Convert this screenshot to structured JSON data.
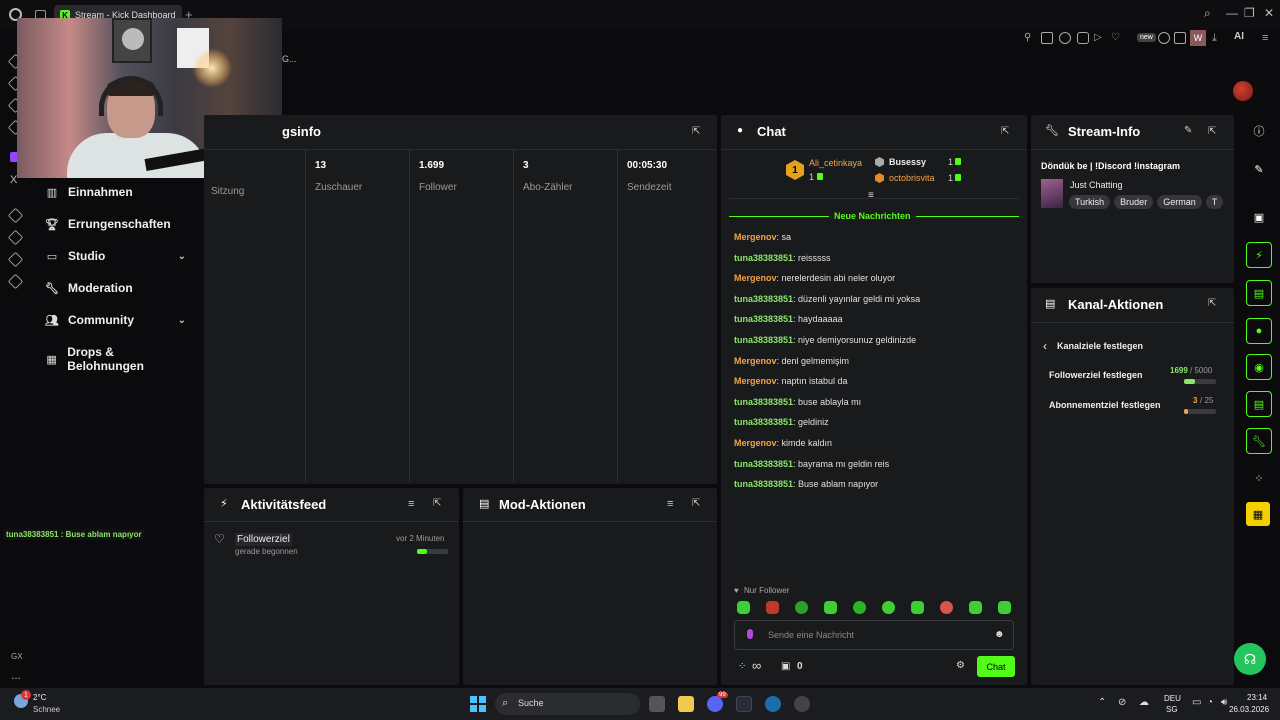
{
  "browser": {
    "tab_title": "Stream - Kick Dashboard",
    "tab_logo": "K",
    "new_tab": "+",
    "new_badge": "new",
    "w_badge": "W",
    "ai_label": "AI",
    "overflow_text": "G..."
  },
  "opera_sidebar": {
    "gx_label": "GX",
    "more": "...",
    "x_label": "X"
  },
  "nav": {
    "items": [
      {
        "label": "Einnahmen",
        "icon": "bar-chart-icon"
      },
      {
        "label": "Errungenschaften",
        "icon": "trophy-icon"
      },
      {
        "label": "Studio",
        "icon": "monitor-icon",
        "expandable": true
      },
      {
        "label": "Moderation",
        "icon": "wrench-icon"
      },
      {
        "label": "Community",
        "icon": "users-icon",
        "expandable": true
      },
      {
        "label": "Drops & Belohnungen",
        "icon": "gift-icon"
      }
    ]
  },
  "overlay_chat": "tuna38383851 : Buse ablam napıyor",
  "session_panel": {
    "title": "gsinfo",
    "stats": [
      {
        "value": "",
        "label": "Sitzung"
      },
      {
        "value": "13",
        "label": "Zuschauer"
      },
      {
        "value": "1.699",
        "label": "Follower"
      },
      {
        "value": "3",
        "label": "Abo-Zähler"
      },
      {
        "value": "00:05:30",
        "label": "Sendezeit"
      }
    ]
  },
  "activity": {
    "title": "Aktivitätsfeed",
    "item_title": "Followerziel",
    "item_sub": "gerade begonnen",
    "item_time": "vor 2 Minuten",
    "progress": 0.33
  },
  "mod_actions": {
    "title": "Mod-Aktionen"
  },
  "chat": {
    "title": "Chat",
    "top_users": [
      {
        "name": "Ali_cetinkaya",
        "count": "1",
        "rank": "1"
      },
      {
        "name": "Busessy",
        "count": "1"
      },
      {
        "name": "octobrisvita",
        "count": "1"
      }
    ],
    "new_messages": "Neue Nachrichten",
    "messages": [
      {
        "user": "Mergenov",
        "color": "orange",
        "text": ": sa"
      },
      {
        "user": "tuna38383851",
        "color": "green",
        "text": ": reisssss"
      },
      {
        "user": "Mergenov",
        "color": "orange",
        "text": ": nerelerdesin abi neler oluyor"
      },
      {
        "user": "tuna38383851",
        "color": "green",
        "text": ": düzenli yayınlar geldi mi yoksa"
      },
      {
        "user": "tuna38383851",
        "color": "green",
        "text": ": haydaaaaa"
      },
      {
        "user": "tuna38383851",
        "color": "green",
        "text": ": niye demiyorsunuz geldinizde"
      },
      {
        "user": "Mergenov",
        "color": "orange",
        "text": ": denl gelmemişim"
      },
      {
        "user": "Mergenov",
        "color": "orange",
        "text": ": naptın istabul da"
      },
      {
        "user": "tuna38383851",
        "color": "green",
        "text": ": buse ablayla mı"
      },
      {
        "user": "tuna38383851",
        "color": "green",
        "text": ": geldiniz"
      },
      {
        "user": "Mergenov",
        "color": "orange",
        "text": ": kimde kaldın"
      },
      {
        "user": "tuna38383851",
        "color": "green",
        "text": ": bayrama mı geldin reis"
      },
      {
        "user": "tuna38383851",
        "color": "green",
        "text": ": Buse ablam napıyor"
      }
    ],
    "followers_only": "Nur Follower",
    "input_placeholder": "Sende eine Nachricht",
    "points": "∞",
    "store_count": "0",
    "send_label": "Chat"
  },
  "stream_info": {
    "title": "Stream-Info",
    "stream_title": "Döndük be | !Discord !instagram",
    "category": "Just Chatting",
    "tags": [
      "Turkish",
      "Bruder",
      "German",
      "T"
    ]
  },
  "channel_actions": {
    "title": "Kanal-Aktionen",
    "back_label": "Kanalziele festlegen",
    "goals": [
      {
        "label": "Followerziel festlegen",
        "current": "1699",
        "target": "/ 5000",
        "progress": 0.34
      },
      {
        "label": "Abonnementziel festlegen",
        "current": "3",
        "target": "/ 25",
        "progress": 0.12
      }
    ]
  },
  "taskbar": {
    "weather_temp": "2°C",
    "weather_desc": "Schnee",
    "weather_badge": "1",
    "search_label": "Suche",
    "lang_top": "DEU",
    "lang_bottom": "SG",
    "time": "23:14",
    "date": "26.03.2026",
    "discord_badge": "99"
  },
  "colors": {
    "accent": "#53fc18",
    "panel": "#191a1c",
    "orange_user": "#f3a34a",
    "green_user": "#8ce66a"
  }
}
